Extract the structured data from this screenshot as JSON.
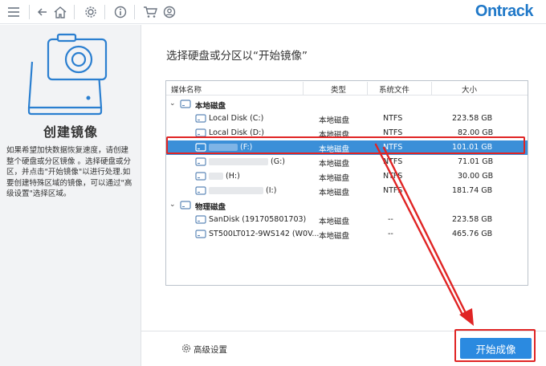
{
  "toolbar": {
    "icons": [
      "menu-icon",
      "back-icon",
      "home-icon",
      "settings-icon",
      "info-icon",
      "cart-icon",
      "account-icon"
    ],
    "brand": "Ontrack"
  },
  "left": {
    "title": "创建镜像",
    "description": "如果希望加快数据恢复速度，请创建整个硬盘或分区镜像 。选择硬盘或分区，并点击\"开始镜像\"以进行处理.如要创建特殊区域的镜像，可以通过\"高级设置\"选择区域。"
  },
  "main": {
    "title": "选择硬盘或分区以“开始镜像”",
    "columns": [
      "媒体名称",
      "类型",
      "系统文件",
      "大小"
    ],
    "groups": [
      {
        "label": "本地磁盘",
        "rows": [
          {
            "name": "Local Disk (C:)",
            "type": "本地磁盘",
            "fs": "NTFS",
            "size": "223.58 GB"
          },
          {
            "name": "Local Disk (D:)",
            "type": "本地磁盘",
            "fs": "NTFS",
            "size": "82.00 GB"
          },
          {
            "name": "(F:)",
            "type": "本地磁盘",
            "fs": "NTFS",
            "size": "101.01 GB",
            "selected": true
          },
          {
            "name": "(G:)",
            "type": "本地磁盘",
            "fs": "NTFS",
            "size": "71.01 GB"
          },
          {
            "name": "(H:)",
            "type": "本地磁盘",
            "fs": "NTFS",
            "size": "30.00 GB"
          },
          {
            "name": "(I:)",
            "type": "本地磁盘",
            "fs": "NTFS",
            "size": "181.74 GB"
          }
        ]
      },
      {
        "label": "物理磁盘",
        "rows": [
          {
            "name": "SanDisk (191705801703)",
            "type": "本地磁盘",
            "fs": "--",
            "size": "223.58 GB"
          },
          {
            "name": "ST500LT012-9WS142 (W0V...",
            "type": "本地磁盘",
            "fs": "--",
            "size": "465.76 GB"
          }
        ]
      }
    ]
  },
  "bottom": {
    "advanced_label": "高级设置",
    "start_label": "开始成像"
  },
  "colors": {
    "accent": "#2b8ae0",
    "selection": "#3b8fd8",
    "annotation": "#e02424",
    "brand": "#1f78c8"
  }
}
